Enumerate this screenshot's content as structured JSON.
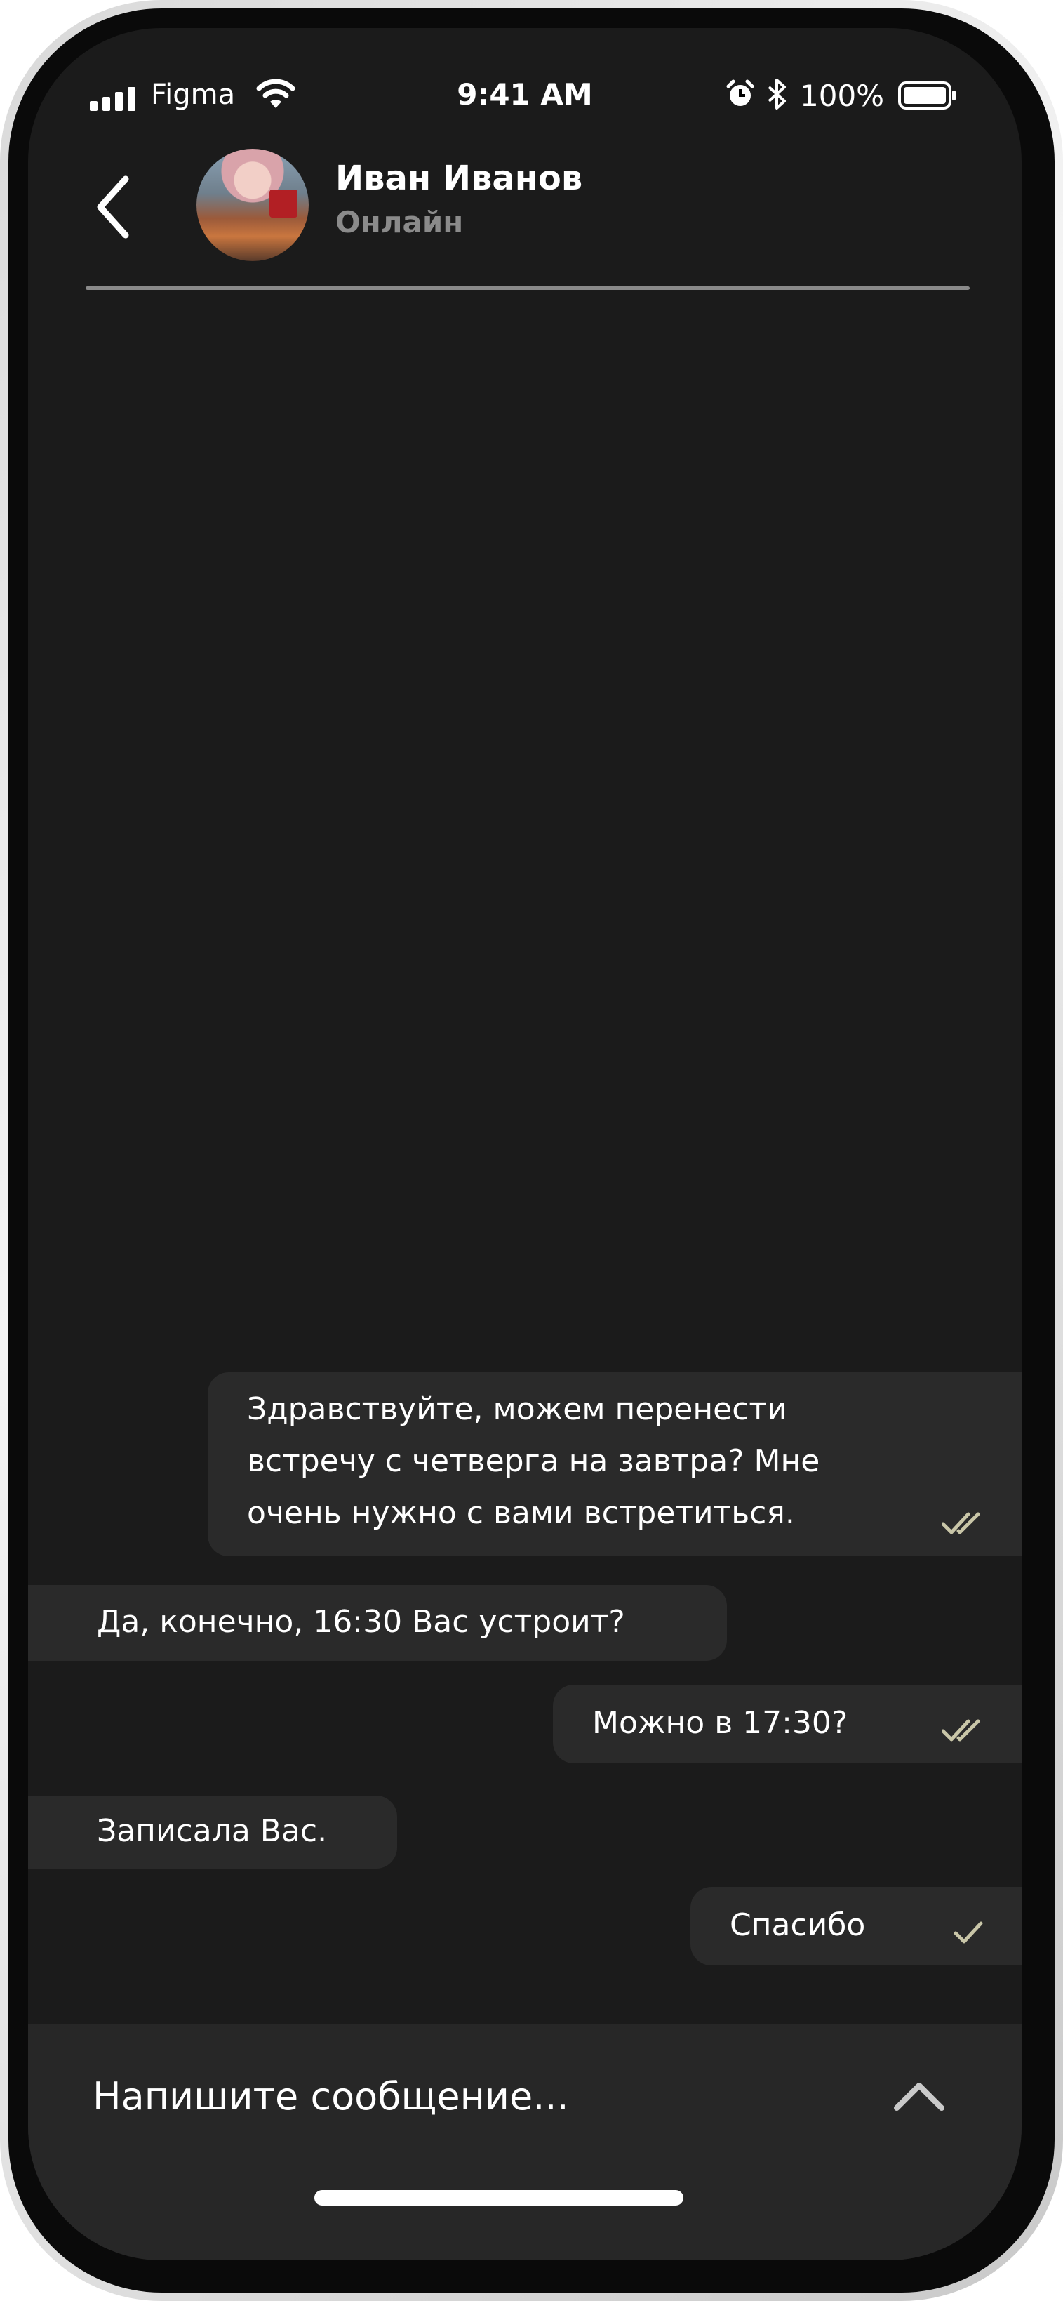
{
  "status_bar": {
    "carrier": "Figma",
    "time": "9:41 AM",
    "battery_percent": "100%",
    "icons": [
      "signal-icon",
      "wifi-icon",
      "alarm-icon",
      "bluetooth-icon",
      "battery-icon"
    ]
  },
  "header": {
    "back_icon": "chevron-left-icon",
    "contact_name": "Иван Иванов",
    "contact_status": "Онлайн"
  },
  "messages": [
    {
      "direction": "outgoing",
      "text": "Здравствуйте, можем перенести\nвстречу с четверга на завтра? Мне\nочень нужно с вами встретиться.",
      "status_icon": "double-check-icon"
    },
    {
      "direction": "incoming",
      "text": "Да, конечно, 16:30 Вас устроит?"
    },
    {
      "direction": "outgoing",
      "text": "Можно в 17:30?",
      "status_icon": "double-check-icon"
    },
    {
      "direction": "incoming",
      "text": "Записала Вас."
    },
    {
      "direction": "outgoing",
      "text": "Спасибо",
      "status_icon": "single-check-icon"
    }
  ],
  "composer": {
    "placeholder": "Напишите сообщение...",
    "expand_icon": "chevron-up-icon"
  },
  "colors": {
    "background": "#1b1b1b",
    "bubble": "#2a2a2a",
    "composer": "#272727",
    "check_mark": "#c9c6a8",
    "secondary_text": "#8b8b8b"
  }
}
